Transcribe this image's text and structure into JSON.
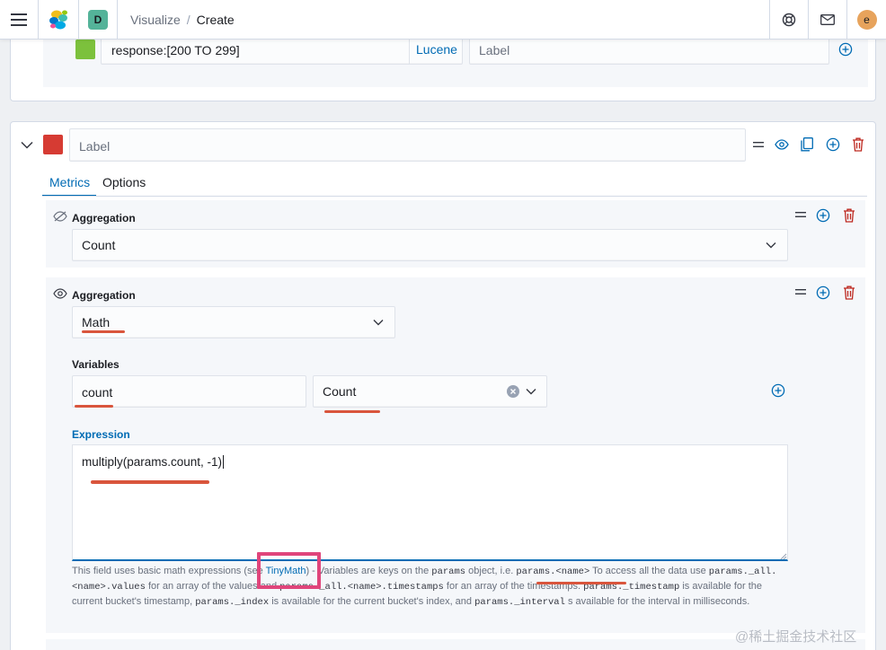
{
  "header": {
    "space_initial": "D",
    "breadcrumb_parent": "Visualize",
    "breadcrumb_separator": "/",
    "breadcrumb_current": "Create",
    "avatar_initial": "e"
  },
  "filter_row": {
    "swatch_color": "#7cc13c",
    "query_value": "response:[200 TO 299]",
    "language_button": "Lucene",
    "label_placeholder": "Label"
  },
  "series": {
    "swatch_color": "#d63b33",
    "label_placeholder": "Label",
    "tabs": [
      {
        "label": "Metrics",
        "active": true
      },
      {
        "label": "Options",
        "active": false
      }
    ]
  },
  "agg1": {
    "title": "Aggregation",
    "value": "Count"
  },
  "agg2": {
    "title": "Aggregation",
    "value": "Math",
    "variables_label": "Variables",
    "var_name": "count",
    "var_metric": "Count",
    "expression_label": "Expression",
    "expression_value": "multiply(params.count, -1)"
  },
  "help": {
    "t1": "This field uses basic math expressions (see ",
    "link": "TinyMath",
    "t2": ") - Variables are keys on the ",
    "c1": "params",
    "t3": " object, i.e. ",
    "c2": "params.<name>",
    "t4": " To access all the data use ",
    "c3": "params._all.<name>.values",
    "t5": " for an array of the values and ",
    "c4": "params._all.<name>.timestamps",
    "t6": " for an array of the timestamps. ",
    "c5": "params._timestamp",
    "t7": " is available for the current bucket's timestamp, ",
    "c6": "params._index",
    "t8": " is available for the current bucket's index, and ",
    "c7": "params._interval",
    "t9": " s available for the interval in milliseconds."
  },
  "watermark": "@稀土掘金技术社区",
  "colors": {
    "accent": "#006bb4",
    "danger": "#bd271e",
    "highlight_box": "#e0457b",
    "annotation_underline": "#d9553c"
  }
}
